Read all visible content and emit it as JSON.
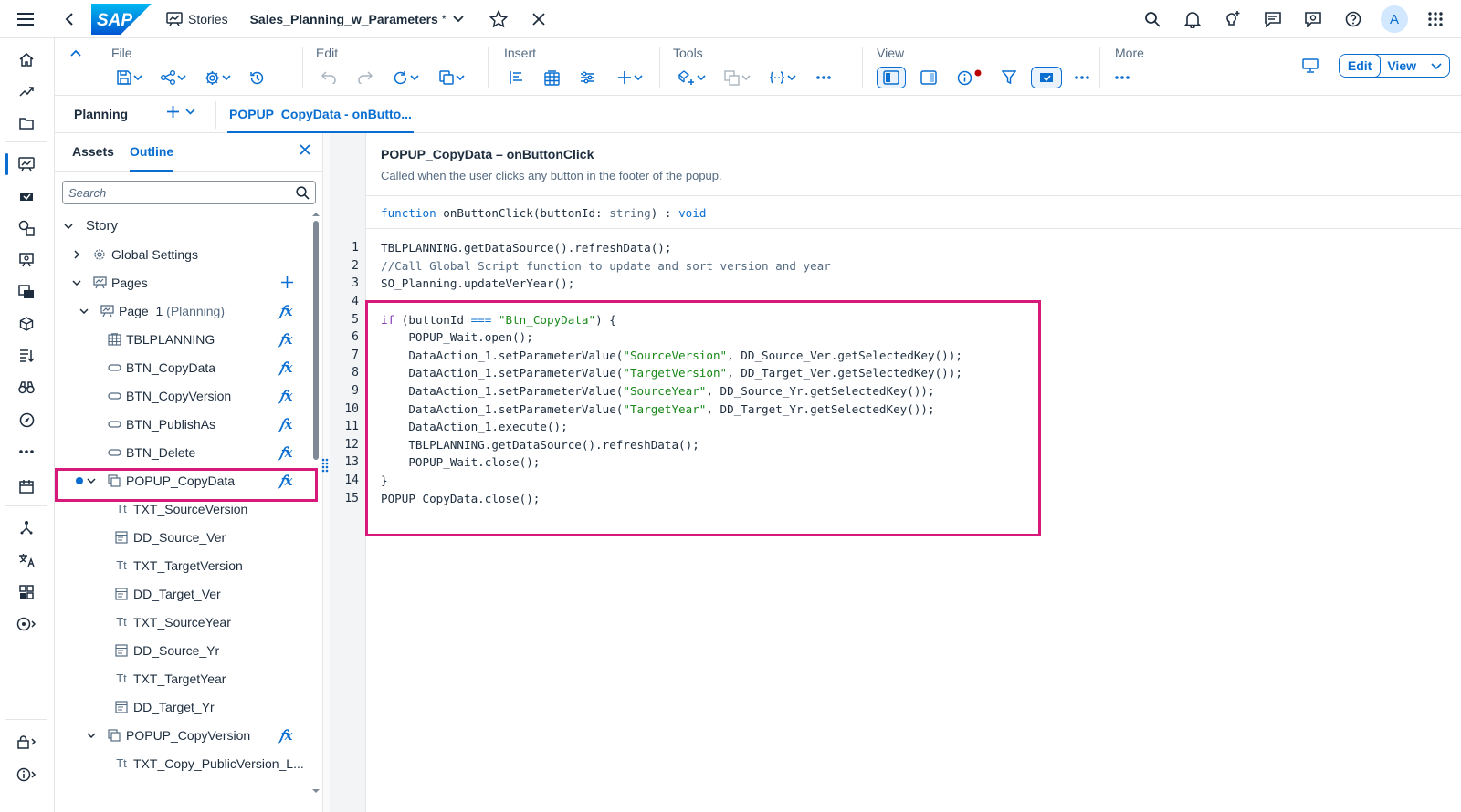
{
  "shell": {
    "logo": "SAP",
    "stories_label": "Stories",
    "story_title": "Sales_Planning_w_Parameters",
    "dirty_marker": "*",
    "avatar_initial": "A"
  },
  "toolbar": {
    "groups": [
      {
        "label": "File"
      },
      {
        "label": "Edit"
      },
      {
        "label": "Insert"
      },
      {
        "label": "Tools"
      },
      {
        "label": "View"
      },
      {
        "label": "More"
      }
    ],
    "mode_edit": "Edit",
    "mode_view": "View"
  },
  "tabs": {
    "planning": "Planning",
    "active": "POPUP_CopyData - onButto..."
  },
  "panel": {
    "tab_assets": "Assets",
    "tab_outline": "Outline",
    "search_placeholder": "Search",
    "tree": [
      {
        "label": "Story",
        "sub": ""
      },
      {
        "label": "Global Settings",
        "sub": ""
      },
      {
        "label": "Pages",
        "sub": ""
      },
      {
        "label": "Page_1",
        "sub": "(Planning)"
      },
      {
        "label": "TBLPLANNING",
        "sub": ""
      },
      {
        "label": "BTN_CopyData",
        "sub": ""
      },
      {
        "label": "BTN_CopyVersion",
        "sub": ""
      },
      {
        "label": "BTN_PublishAs",
        "sub": ""
      },
      {
        "label": "BTN_Delete",
        "sub": ""
      },
      {
        "label": "POPUP_CopyData",
        "sub": ""
      },
      {
        "label": "TXT_SourceVersion",
        "sub": ""
      },
      {
        "label": "DD_Source_Ver",
        "sub": ""
      },
      {
        "label": "TXT_TargetVersion",
        "sub": ""
      },
      {
        "label": "DD_Target_Ver",
        "sub": ""
      },
      {
        "label": "TXT_SourceYear",
        "sub": ""
      },
      {
        "label": "DD_Source_Yr",
        "sub": ""
      },
      {
        "label": "TXT_TargetYear",
        "sub": ""
      },
      {
        "label": "DD_Target_Yr",
        "sub": ""
      },
      {
        "label": "POPUP_CopyVersion",
        "sub": ""
      },
      {
        "label": "TXT_Copy_PublicVersion_L...",
        "sub": ""
      }
    ]
  },
  "editor": {
    "title": "POPUP_CopyData – onButtonClick",
    "description": "Called when the user clicks any button in the footer of the popup.",
    "signature": {
      "kw": "function",
      "name": " onButtonClick(buttonId: ",
      "type": "string",
      "close": ") : ",
      "ret": "void"
    },
    "line_numbers": [
      "1",
      "2",
      "3",
      "4",
      "5",
      "6",
      "7",
      "8",
      "9",
      "10",
      "11",
      "12",
      "13",
      "14",
      "15"
    ],
    "lines": {
      "l1": "TBLPLANNING.getDataSource().refreshData();",
      "l2": "//Call Global Script function to update and sort version and year",
      "l3": "SO_Planning.updateVerYear();",
      "l5_kw": "if",
      "l5_a": " (buttonId ",
      "l5_op": "===",
      "l5_b": " ",
      "l5_str": "\"Btn_CopyData\"",
      "l5_c": ") {",
      "l6": "    POPUP_Wait.open();",
      "l7_a": "    DataAction_1.setParameterValue(",
      "l7_str": "\"SourceVersion\"",
      "l7_b": ", DD_Source_Ver.getSelectedKey());",
      "l8_a": "    DataAction_1.setParameterValue(",
      "l8_str": "\"TargetVersion\"",
      "l8_b": ", DD_Target_Ver.getSelectedKey());",
      "l9_a": "    DataAction_1.setParameterValue(",
      "l9_str": "\"SourceYear\"",
      "l9_b": ", DD_Source_Yr.getSelectedKey());",
      "l10_a": "    DataAction_1.setParameterValue(",
      "l10_str": "\"TargetYear\"",
      "l10_b": ", DD_Target_Yr.getSelectedKey());",
      "l11": "    DataAction_1.execute();",
      "l12": "    TBLPLANNING.getDataSource().refreshData();",
      "l13": "    POPUP_Wait.close();",
      "l14": "}",
      "l15": "POPUP_CopyData.close();"
    }
  },
  "colors": {
    "accent": "#0a6ed1",
    "highlight": "#d6197a",
    "keyword": "#7a2fb0",
    "string": "#188918"
  }
}
